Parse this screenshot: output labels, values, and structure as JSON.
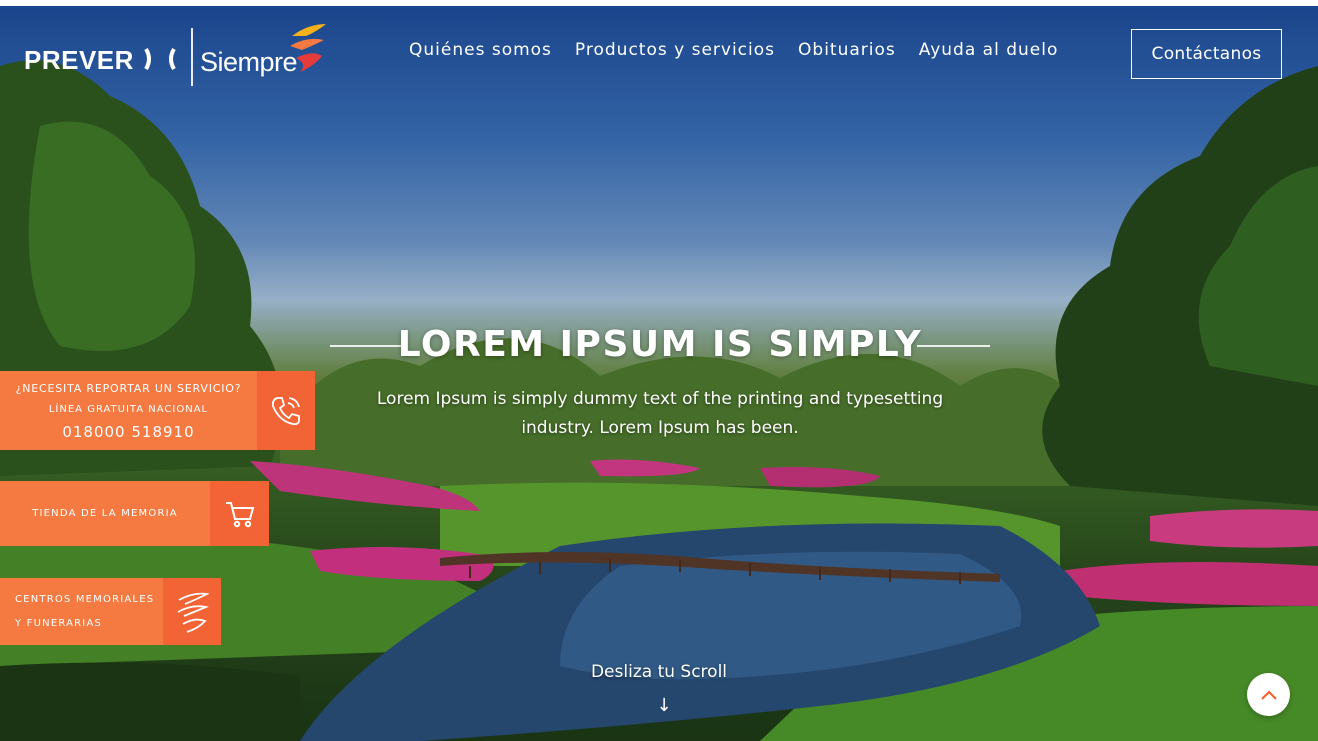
{
  "header": {
    "logo_prever": "PREVER",
    "logo_siempre": "Siempre",
    "nav": [
      "Quiénes somos",
      "Productos y servicios",
      "Obituarios",
      "Ayuda al duelo"
    ],
    "contact_label": "Contáctanos"
  },
  "hero": {
    "title": "LOREM IPSUM IS SIMPLY",
    "subtitle": "Lorem Ipsum is simply dummy text of the printing and typesetting industry. Lorem Ipsum has been.",
    "scroll_label": "Desliza tu Scroll",
    "scroll_arrow": "↓"
  },
  "widgets": {
    "report": {
      "line1": "¿NECESITA REPORTAR UN SERVICIO?",
      "line2": "LÍNEA GRATUITA NACIONAL",
      "phone": "018000 518910",
      "icon": "phone-icon"
    },
    "store": {
      "label": "TIENDA DE LA MEMORIA",
      "icon": "cart-icon"
    },
    "centers": {
      "line1": "CENTROS MEMORIALES",
      "line2": "Y FUNERARIAS",
      "icon": "siempre-s-icon"
    }
  },
  "colors": {
    "accent": "#f47a41",
    "accent_dark": "#f26335",
    "text_light": "#ffffff"
  }
}
